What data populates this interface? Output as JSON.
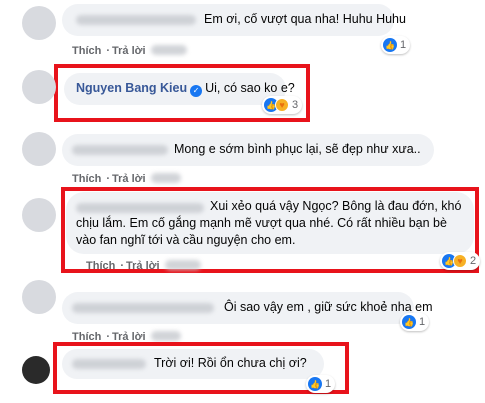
{
  "comments": [
    {
      "author": "",
      "text": "Em ơi, cố vượt qua nha! Huhu Huhu",
      "like_label": "Thích",
      "reply_label": "Trả lời",
      "reaction_count": "1"
    },
    {
      "author": "Nguyen Bang Kieu",
      "text": "Ui, có sao ko e?",
      "like_label": "Thích",
      "reply_label": "Trả lời",
      "reaction_count": "3"
    },
    {
      "author": "",
      "text_prefix": "Mong",
      "text": "e sớm bình phục lại, sẽ đẹp như xưa..",
      "like_label": "Thích",
      "reply_label": "Trả lời"
    },
    {
      "author": "",
      "text_line1": "Xui xẻo quá vậy Ngọc? Bông là đau đớn, khó",
      "text_line2": "chịu lắm. Em cố gắng mạnh mẽ vượt qua nhé. Có rất nhiều bạn bè",
      "text_line3": "vào fan nghĩ tới và cầu nguyện cho em.",
      "like_label": "Thích",
      "reply_label": "Trả lời",
      "reaction_count": "2"
    },
    {
      "author": "",
      "text": "Ôi sao vậy em , giữ sức khoẻ nha em",
      "like_label": "Thích",
      "reply_label": "Trả lời",
      "reaction_count": "1"
    },
    {
      "author": "",
      "text": "Trời ơi! Rồi ổn chưa chị ơi?",
      "reaction_count": "1"
    }
  ],
  "icons": {
    "like": "like-icon",
    "care": "care-icon",
    "verified": "verified-badge-icon"
  },
  "colors": {
    "highlight_box": "#e8131b",
    "like_blue": "#1877f2",
    "bubble_bg": "#f0f2f5"
  }
}
